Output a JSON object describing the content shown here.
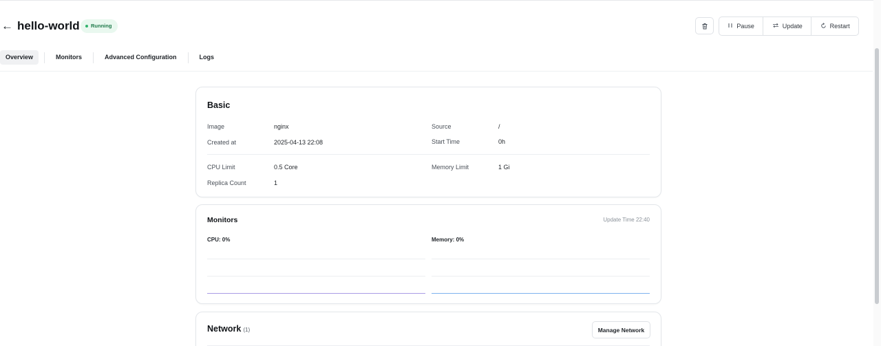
{
  "header": {
    "app_name": "hello-world",
    "status": "Running",
    "back_icon": "←",
    "delete_icon": "trash-icon",
    "actions": {
      "pause": "Pause",
      "update": "Update",
      "restart": "Restart"
    }
  },
  "tabs": [
    {
      "label": "Overview",
      "active": true
    },
    {
      "label": "Monitors",
      "active": false
    },
    {
      "label": "Advanced Configuration",
      "active": false
    },
    {
      "label": "Logs",
      "active": false
    }
  ],
  "basic": {
    "title": "Basic",
    "image_label": "Image",
    "image_value": "nginx",
    "source_label": "Source",
    "source_value": "/",
    "created_label": "Created at",
    "created_value": "2025-04-13 22:08",
    "start_label": "Start Time",
    "start_value": "0h",
    "cpu_label": "CPU Limit",
    "cpu_value": "0.5 Core",
    "memory_label": "Memory Limit",
    "memory_value": "1 Gi",
    "replica_label": "Replica Count",
    "replica_value": "1"
  },
  "monitors": {
    "title": "Monitors",
    "update_time_label": "Update Time",
    "update_time_value": "22:40",
    "cpu_label": "CPU:",
    "cpu_value": "0%",
    "memory_label": "Memory:",
    "memory_value": "0%"
  },
  "network": {
    "title": "Network",
    "count": "(1)",
    "manage_button": "Manage Network"
  },
  "colors": {
    "status_bg": "#e9f8ef",
    "status_text": "#1f7a4a",
    "cpu_line": "#a99be6",
    "memory_line": "#7db2ee"
  }
}
